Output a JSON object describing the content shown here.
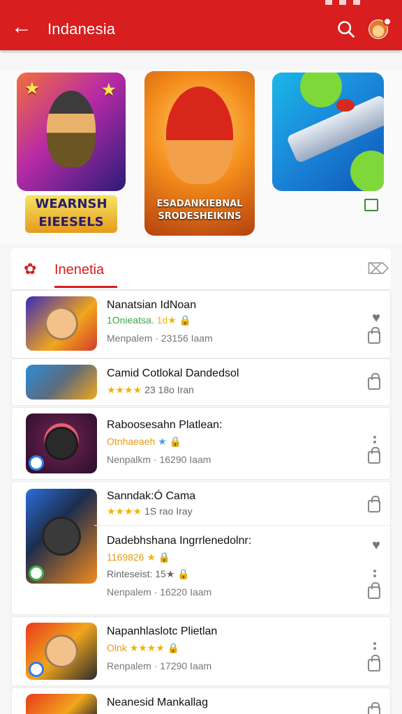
{
  "app_bar": {
    "title": "Indanesia",
    "back_icon": "arrow-left-icon",
    "search_icon": "search-icon",
    "avatar": "avatar"
  },
  "featured": {
    "items": [
      {
        "logo": "WEARNSH EIEESELS"
      },
      {
        "logo": "ESADANKIEBNAL SRODESHEIKINS"
      },
      {
        "logo": ""
      }
    ]
  },
  "section": {
    "tab_label": "Inenetia",
    "close_icon": "close-icon"
  },
  "apps": [
    {
      "name": "Nanatsian IdNoan",
      "tag": "1Onieatsa.",
      "stars": "1d★",
      "meta": "Menpalem · 23156 Iaam"
    },
    {
      "name": "Camid Cotlokal Dandedsol",
      "stars": "★★★★",
      "meta": "23 18o Iran"
    },
    {
      "name": "Raboosesahn Platlean:",
      "tag": "Otnhaeaeh",
      "stars": "★",
      "meta": "Nenpalkm · 16290 Iaam"
    },
    {
      "name": "Sanndak:Ó Cama",
      "stars": "★★★★",
      "meta": "1S rao Iray"
    },
    {
      "name": "Dadebhshana Ingrrlenedolnr:",
      "tag": "1169826",
      "stars": "★",
      "sub": "Rinteseist: 15★",
      "meta": "Nenpalem · 16220 Iaam"
    },
    {
      "name": "Napanhlaslotc Plietlan",
      "tag": "Olnk",
      "stars": "★★★★",
      "meta": "Renpalem · 17290 Iaam"
    },
    {
      "name": "Neanesid Mankallag"
    }
  ]
}
